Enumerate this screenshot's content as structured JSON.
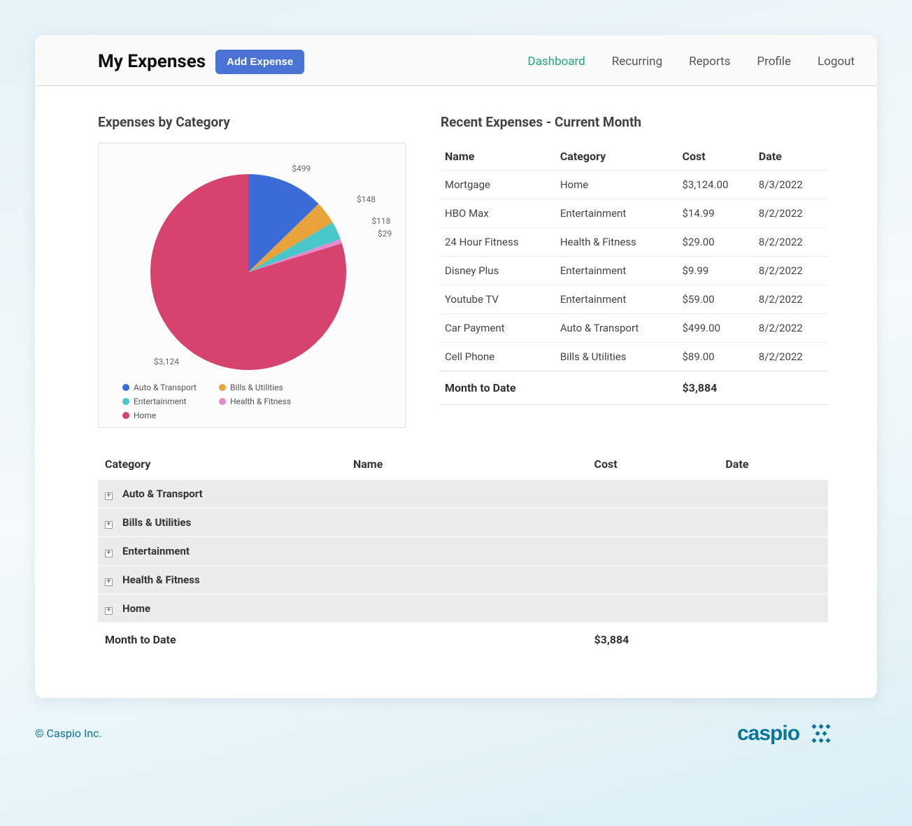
{
  "header": {
    "title": "My Expenses",
    "add_button": "Add Expense",
    "nav": [
      "Dashboard",
      "Recurring",
      "Reports",
      "Profile",
      "Logout"
    ],
    "active_index": 0
  },
  "sections": {
    "pie_title": "Expenses by Category",
    "recent_title": "Recent Expenses - Current Month"
  },
  "chart_data": {
    "type": "pie",
    "title": "Expenses by Category",
    "series": [
      {
        "name": "Auto & Transport",
        "value": 499,
        "label": "$499",
        "color": "#3a6bd6"
      },
      {
        "name": "Bills & Utilities",
        "value": 148,
        "label": "$148",
        "color": "#e8a43a"
      },
      {
        "name": "Entertainment",
        "value": 118,
        "label": "$118",
        "color": "#49c7c9"
      },
      {
        "name": "Health & Fitness",
        "value": 29,
        "label": "$29",
        "color": "#e68ad0"
      },
      {
        "name": "Home",
        "value": 3124,
        "label": "$3,124",
        "color": "#d6436f"
      }
    ]
  },
  "recent": {
    "columns": [
      "Name",
      "Category",
      "Cost",
      "Date"
    ],
    "rows": [
      {
        "name": "Mortgage",
        "category": "Home",
        "cost": "$3,124.00",
        "date": "8/3/2022"
      },
      {
        "name": "HBO Max",
        "category": "Entertainment",
        "cost": "$14.99",
        "date": "8/2/2022"
      },
      {
        "name": "24 Hour Fitness",
        "category": "Health & Fitness",
        "cost": "$29.00",
        "date": "8/2/2022"
      },
      {
        "name": "Disney Plus",
        "category": "Entertainment",
        "cost": "$9.99",
        "date": "8/2/2022"
      },
      {
        "name": "Youtube TV",
        "category": "Entertainment",
        "cost": "$59.00",
        "date": "8/2/2022"
      },
      {
        "name": "Car Payment",
        "category": "Auto & Transport",
        "cost": "$499.00",
        "date": "8/2/2022"
      },
      {
        "name": "Cell Phone",
        "category": "Bills & Utilities",
        "cost": "$89.00",
        "date": "8/2/2022"
      }
    ],
    "footer_label": "Month to Date",
    "footer_total": "$3,884"
  },
  "grouped": {
    "columns": [
      "Category",
      "Name",
      "Cost",
      "Date"
    ],
    "groups": [
      "Auto & Transport",
      "Bills & Utilities",
      "Entertainment",
      "Health & Fitness",
      "Home"
    ],
    "footer_label": "Month to Date",
    "footer_total": "$3,884"
  },
  "footer": {
    "copyright": "© Caspio Inc.",
    "logo_text": "caspio"
  }
}
